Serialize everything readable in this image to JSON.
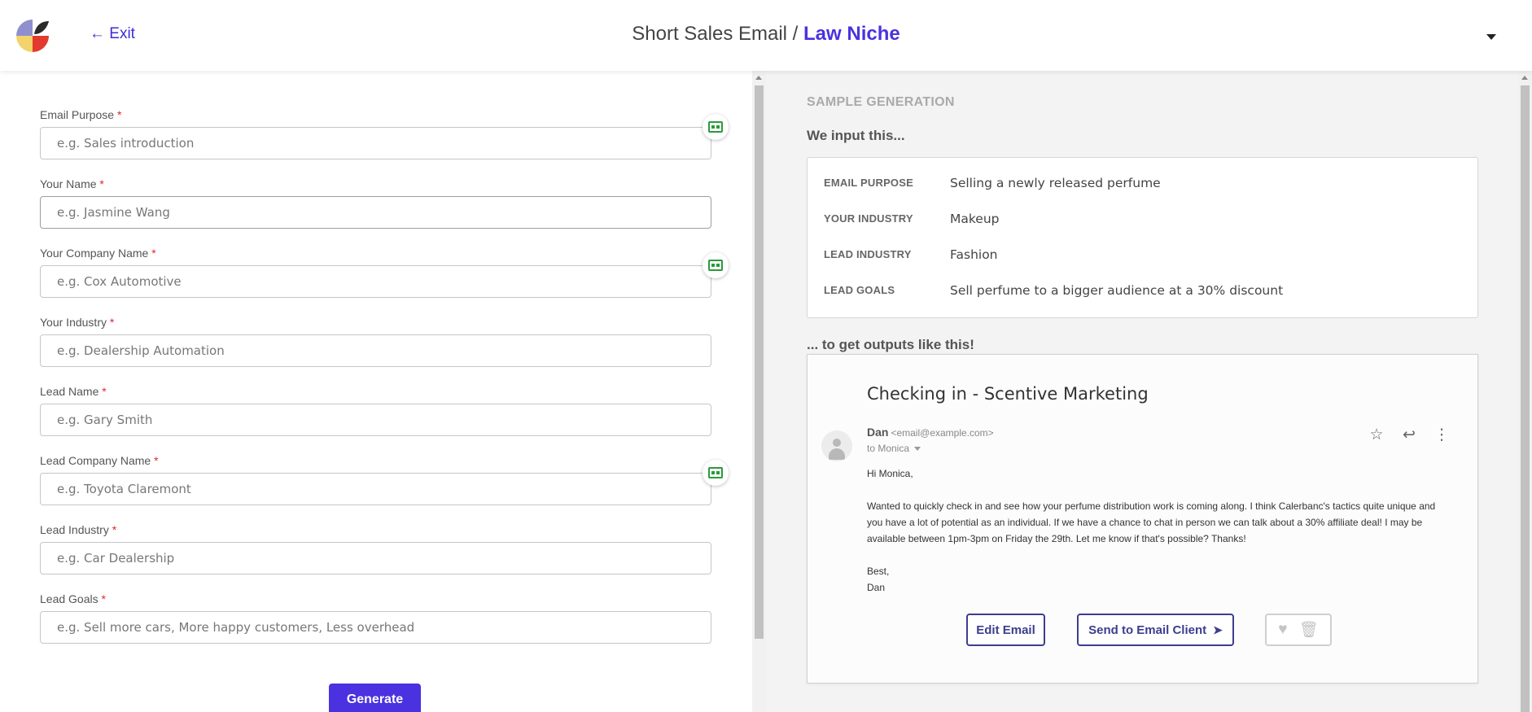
{
  "header": {
    "exit_label": "← Exit",
    "title_prefix": "Short Sales Email / ",
    "title_niche": "Law Niche"
  },
  "form": {
    "fields": [
      {
        "label": "Email Purpose",
        "required": "*",
        "placeholder": "e.g. Sales introduction"
      },
      {
        "label": "Your Name",
        "required": "*",
        "placeholder": "e.g. Jasmine Wang"
      },
      {
        "label": "Your Company Name",
        "required": "*",
        "placeholder": "e.g. Cox Automotive"
      },
      {
        "label": "Your Industry",
        "required": "*",
        "placeholder": "e.g. Dealership Automation"
      },
      {
        "label": "Lead Name",
        "required": "*",
        "placeholder": "e.g. Gary Smith"
      },
      {
        "label": "Lead Company Name",
        "required": "*",
        "placeholder": "e.g. Toyota Claremont"
      },
      {
        "label": "Lead Industry",
        "required": "*",
        "placeholder": "e.g. Car Dealership"
      },
      {
        "label": "Lead Goals",
        "required": "*",
        "placeholder": "e.g. Sell more cars, More happy customers, Less overhead"
      }
    ],
    "generate_label": "Generate"
  },
  "sample": {
    "heading": "SAMPLE GENERATION",
    "input_heading": "We input this...",
    "inputs": [
      {
        "key": "EMAIL PURPOSE",
        "value": "Selling a newly released perfume"
      },
      {
        "key": "YOUR INDUSTRY",
        "value": "Makeup"
      },
      {
        "key": "LEAD INDUSTRY",
        "value": "Fashion"
      },
      {
        "key": "LEAD GOALS",
        "value": "Sell perfume to a bigger audience at a 30% discount"
      }
    ],
    "output_heading": "... to get outputs like this!",
    "email": {
      "subject": "Checking in - Scentive Marketing",
      "sender_name": "Dan",
      "sender_email": "<email@example.com>",
      "to": "to Monica",
      "greeting": "Hi Monica,",
      "body": "Wanted to quickly check in and see how your perfume distribution work is coming along. I think Calerbanc's tactics quite unique and you have a lot of potential as an individual. If we have a chance to chat in person we can talk about a 30% affiliate deal! I may be available between 1pm-3pm on Friday the 29th. Let me know if that's possible? Thanks!",
      "signoff": "Best,",
      "signature": "Dan"
    },
    "edit_label": "Edit Email",
    "send_label": "Send to Email Client"
  },
  "colors": {
    "accent": "#4a32e0",
    "required": "#e2262f",
    "ai_badge": "#2b9a3a",
    "button_outline": "#3d3d8f"
  },
  "icons": [
    "logo-icon",
    "robot-icon",
    "star-icon",
    "reply-icon",
    "more-vertical-icon",
    "send-plane-icon",
    "heart-icon",
    "trash-icon",
    "chevron-down-icon",
    "avatar-icon"
  ]
}
